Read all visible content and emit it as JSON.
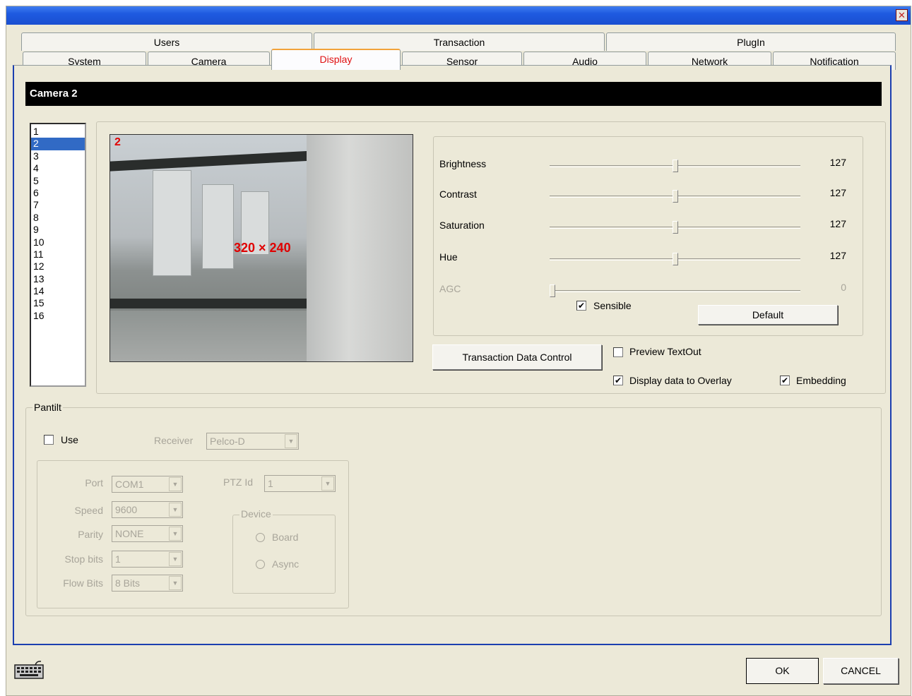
{
  "window": {
    "close_glyph": "✕"
  },
  "tabs": {
    "row1": [
      {
        "label": "Users"
      },
      {
        "label": "Transaction"
      },
      {
        "label": "PlugIn"
      }
    ],
    "row2": [
      {
        "label": "System"
      },
      {
        "label": "Camera"
      },
      {
        "label": "Display",
        "active": true
      },
      {
        "label": "Sensor"
      },
      {
        "label": "Audio"
      },
      {
        "label": "Network"
      },
      {
        "label": "Notification"
      }
    ]
  },
  "camera_header": "Camera 2",
  "camera_list": [
    "1",
    "2",
    "3",
    "4",
    "5",
    "6",
    "7",
    "8",
    "9",
    "10",
    "11",
    "12",
    "13",
    "14",
    "15",
    "16"
  ],
  "camera_selected": "2",
  "preview": {
    "channel": "2",
    "resolution": "320 × 240"
  },
  "sliders": [
    {
      "label": "Brightness",
      "value": "127",
      "level": 0.5
    },
    {
      "label": "Contrast",
      "value": "127",
      "level": 0.5
    },
    {
      "label": "Saturation",
      "value": "127",
      "level": 0.5
    },
    {
      "label": "Hue",
      "value": "127",
      "level": 0.5
    },
    {
      "label": "AGC",
      "value": "0",
      "level": 0.0,
      "disabled": true
    }
  ],
  "sensible": {
    "label": "Sensible",
    "checked": true
  },
  "default_button": "Default",
  "transaction_button": "Transaction Data Control",
  "preview_textout": {
    "label": "Preview TextOut",
    "checked": false
  },
  "display_overlay": {
    "label": "Display data to Overlay",
    "checked": true
  },
  "embedding": {
    "label": "Embedding",
    "checked": true
  },
  "pantilt": {
    "legend": "Pantilt",
    "use": {
      "label": "Use",
      "checked": false
    },
    "receiver": {
      "label": "Receiver",
      "value": "Pelco-D"
    },
    "port": {
      "label": "Port",
      "value": "COM1"
    },
    "speed": {
      "label": "Speed",
      "value": "9600"
    },
    "parity": {
      "label": "Parity",
      "value": "NONE"
    },
    "stop_bits": {
      "label": "Stop bits",
      "value": "1"
    },
    "flow_bits": {
      "label": "Flow Bits",
      "value": "8 Bits"
    },
    "ptz_id": {
      "label": "PTZ Id",
      "value": "1"
    },
    "device": {
      "legend": "Device",
      "board": "Board",
      "async": "Async"
    }
  },
  "footer": {
    "ok": "OK",
    "cancel": "CANCEL"
  },
  "icons": {
    "keyboard": "keyboard-icon",
    "close": "close-icon",
    "dropdown": "chevron-down-icon"
  }
}
